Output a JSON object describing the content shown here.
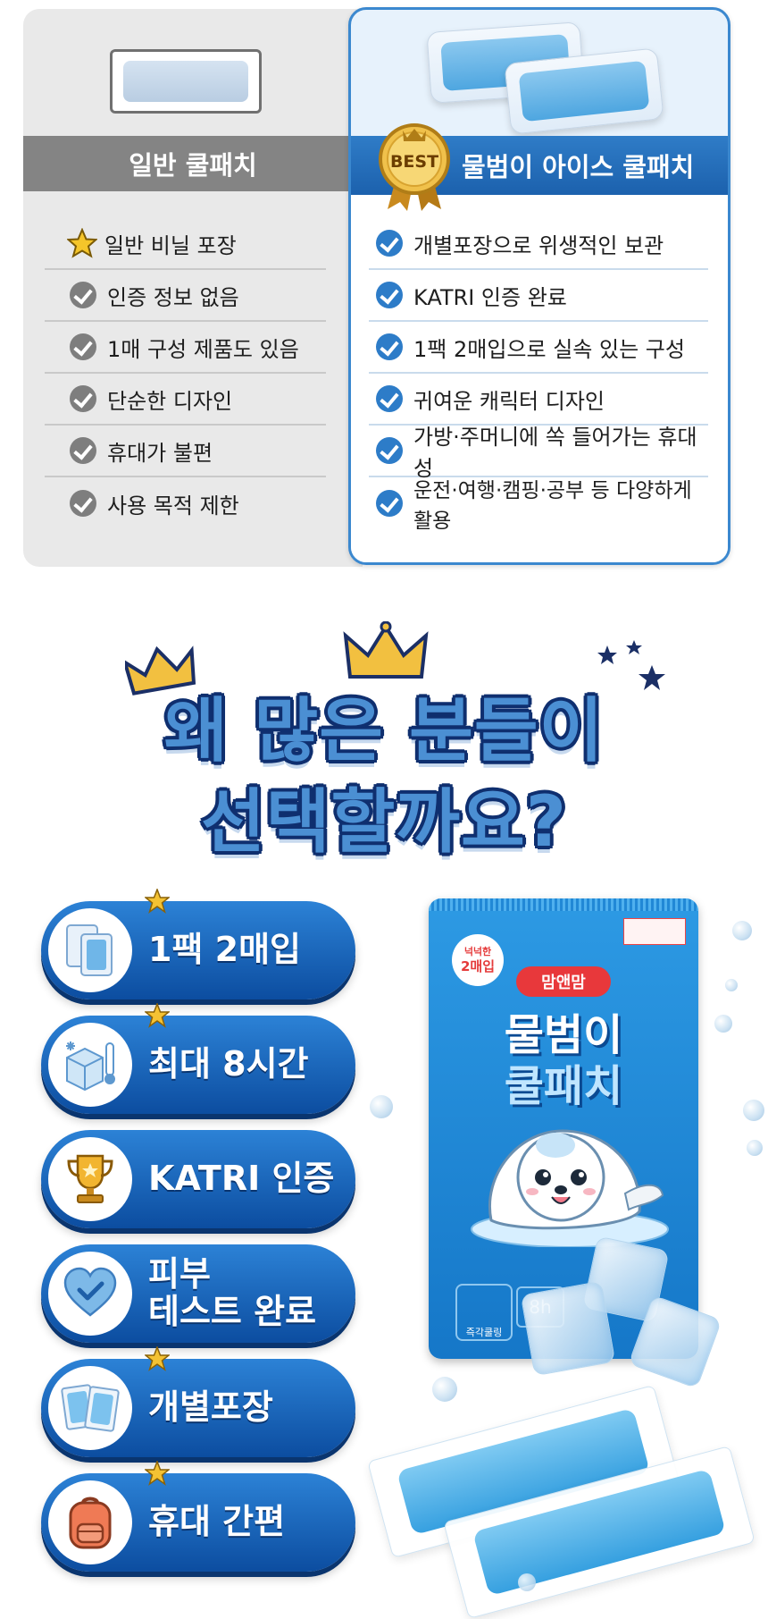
{
  "comparison": {
    "left": {
      "title": "일반 쿨패치",
      "items": [
        "일반 비닐 포장",
        "인증 정보 없음",
        "1매 구성 제품도 있음",
        "단순한 디자인",
        "휴대가 불편",
        "사용 목적 제한"
      ]
    },
    "right": {
      "badge": "BEST",
      "title": "물범이 아이스 쿨패치",
      "items": [
        "개별포장으로 위생적인 보관",
        "KATRI 인증 완료",
        "1팩 2매입으로 실속 있는 구성",
        "귀여운 캐릭터 디자인",
        "가방·주머니에 쏙 들어가는 휴대성",
        "운전·여행·캠핑·공부 등 다양하게 활용"
      ]
    }
  },
  "headline": {
    "line1": "왜 많은 분들이",
    "line2": "선택할까요?"
  },
  "features": [
    {
      "label": "1팩 2매입",
      "icon": "patches-icon"
    },
    {
      "label": "최대 8시간",
      "icon": "ice-thermometer-icon"
    },
    {
      "label": "KATRI 인증",
      "icon": "trophy-icon"
    },
    {
      "label_line1": "피부",
      "label_line2": "테스트 완료",
      "icon": "heart-check-icon"
    },
    {
      "label": "개별포장",
      "icon": "individual-pack-icon"
    },
    {
      "label": "휴대 간편",
      "icon": "backpack-icon"
    }
  ],
  "product": {
    "badge_small": "넉넉한",
    "badge_big": "2매입",
    "brand": "맘앤맘",
    "title1": "물범이",
    "title2": "쿨패치",
    "hours": "8h",
    "foot_label": "즉각쿨링"
  },
  "colors": {
    "brand_blue": "#1c61ad",
    "grey": "#848484",
    "gold": "#f2b530"
  }
}
